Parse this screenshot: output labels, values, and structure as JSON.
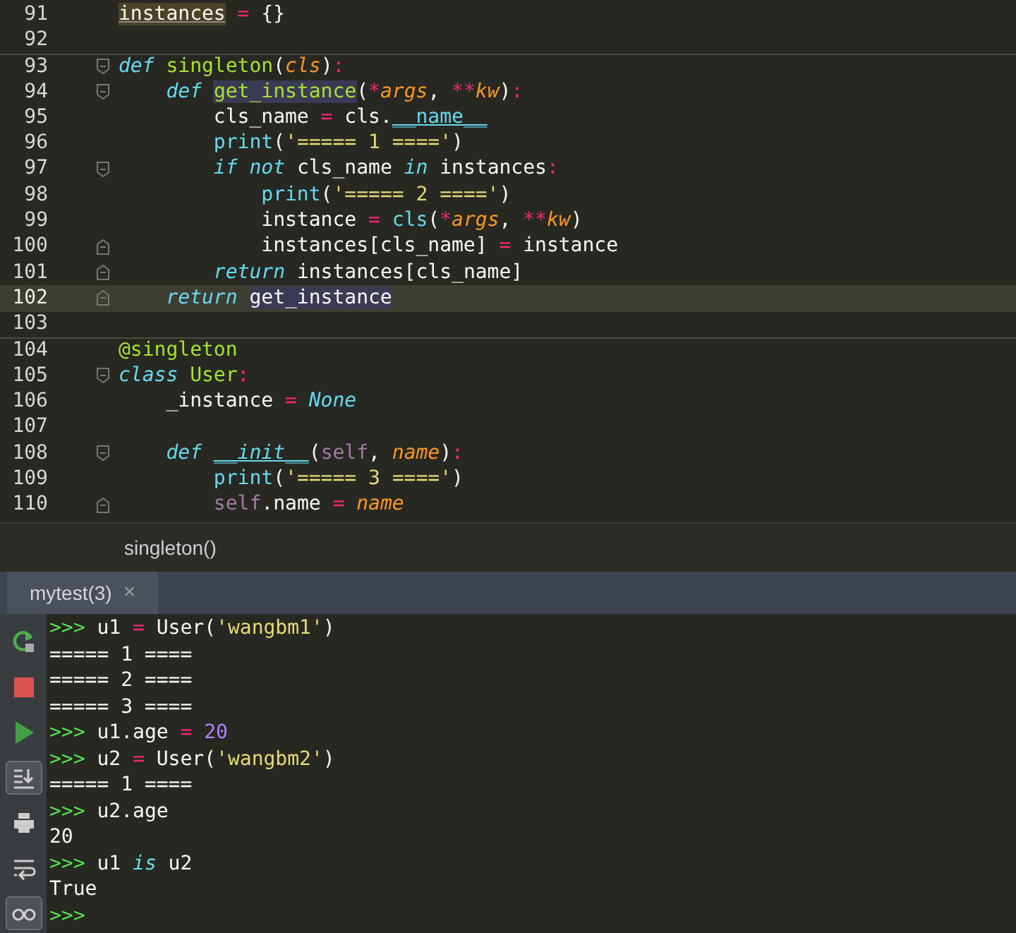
{
  "editor": {
    "lines": [
      {
        "number": "91",
        "current": false,
        "separator": false,
        "tokens": [
          {
            "text": "instances",
            "kind": "var-hl"
          },
          {
            "text": " = ",
            "kind": "op"
          },
          {
            "text": "{}",
            "kind": "plain"
          }
        ]
      },
      {
        "number": "92",
        "current": false,
        "separator": false
      },
      {
        "number": "93",
        "current": false,
        "separator": true,
        "kind": "opener",
        "tokens": [
          {
            "text": "def ",
            "kind": "kw"
          },
          {
            "text": "singleton",
            "kind": "fn"
          },
          {
            "text": "(",
            "kind": "plain"
          },
          {
            "text": "cls",
            "kind": "param"
          },
          {
            "text": ")",
            "kind": "plain"
          },
          {
            "text": ":",
            "kind": "op"
          }
        ]
      },
      {
        "number": "94",
        "current": false,
        "separator": false,
        "kind": "opener",
        "tokens": [
          {
            "text": "    def ",
            "kind": "kw"
          },
          {
            "text": "get_instance",
            "kind": "fn-hl"
          },
          {
            "text": "(",
            "kind": "plain"
          },
          {
            "text": "*",
            "kind": "op"
          },
          {
            "text": "args",
            "kind": "param"
          },
          {
            "text": ", ",
            "kind": "plain"
          },
          {
            "text": "**",
            "kind": "op"
          },
          {
            "text": "kw",
            "kind": "param"
          },
          {
            "text": ")",
            "kind": "plain"
          },
          {
            "text": ":",
            "kind": "op"
          }
        ]
      },
      {
        "number": "95",
        "current": false,
        "separator": false,
        "tokens": [
          {
            "text": "        cls_name ",
            "kind": "plain"
          },
          {
            "text": "=",
            "kind": "op"
          },
          {
            "text": " cls.",
            "kind": "plain"
          },
          {
            "text": "__name__",
            "kind": "dunder"
          }
        ]
      },
      {
        "number": "96",
        "current": false,
        "separator": false,
        "tokens": [
          {
            "text": "        print",
            "kind": "builtin"
          },
          {
            "text": "(",
            "kind": "plain"
          },
          {
            "text": "'===== 1 ===='",
            "kind": "str"
          },
          {
            "text": ")",
            "kind": "plain"
          }
        ]
      },
      {
        "number": "97",
        "current": false,
        "separator": false,
        "kind": "opener",
        "tokens": [
          {
            "text": "        if not",
            "kind": "kw"
          },
          {
            "text": " cls_name ",
            "kind": "plain"
          },
          {
            "text": "in",
            "kind": "kw"
          },
          {
            "text": " instances",
            "kind": "plain"
          },
          {
            "text": ":",
            "kind": "op"
          }
        ]
      },
      {
        "number": "98",
        "current": false,
        "separator": false,
        "tokens": [
          {
            "text": "            print",
            "kind": "builtin"
          },
          {
            "text": "(",
            "kind": "plain"
          },
          {
            "text": "'===== 2 ===='",
            "kind": "str"
          },
          {
            "text": ")",
            "kind": "plain"
          }
        ]
      },
      {
        "number": "99",
        "current": false,
        "separator": false,
        "tokens": [
          {
            "text": "            instance ",
            "kind": "plain"
          },
          {
            "text": "= ",
            "kind": "op"
          },
          {
            "text": "cls",
            "kind": "builtin"
          },
          {
            "text": "(",
            "kind": "plain"
          },
          {
            "text": "*",
            "kind": "op"
          },
          {
            "text": "args",
            "kind": "param"
          },
          {
            "text": ", ",
            "kind": "plain"
          },
          {
            "text": "**",
            "kind": "op"
          },
          {
            "text": "kw",
            "kind": "param"
          },
          {
            "text": ")",
            "kind": "plain"
          }
        ]
      },
      {
        "number": "100",
        "current": false,
        "separator": false,
        "kind": "closer",
        "tokens": [
          {
            "text": "            instances[cls_name] ",
            "kind": "plain"
          },
          {
            "text": "=",
            "kind": "op"
          },
          {
            "text": " instance",
            "kind": "plain"
          }
        ]
      },
      {
        "number": "101",
        "current": false,
        "separator": false,
        "kind": "closer",
        "tokens": [
          {
            "text": "        return",
            "kind": "kw"
          },
          {
            "text": " instances[cls_name]",
            "kind": "plain"
          }
        ]
      },
      {
        "number": "102",
        "current": true,
        "separator": false,
        "kind": "closer",
        "tokens": [
          {
            "text": "    return ",
            "kind": "kw"
          },
          {
            "text": "get_instance",
            "kind": "name-hl"
          }
        ]
      },
      {
        "number": "103",
        "current": false,
        "separator": false
      },
      {
        "number": "104",
        "current": false,
        "separator": true,
        "tokens": [
          {
            "text": "@singleton",
            "kind": "decorator"
          }
        ]
      },
      {
        "number": "105",
        "current": false,
        "separator": false,
        "kind": "opener",
        "tokens": [
          {
            "text": "class ",
            "kind": "kw"
          },
          {
            "text": "User",
            "kind": "fn"
          },
          {
            "text": ":",
            "kind": "op"
          }
        ]
      },
      {
        "number": "106",
        "current": false,
        "separator": false,
        "tokens": [
          {
            "text": "    _instance ",
            "kind": "plain"
          },
          {
            "text": "= ",
            "kind": "op"
          },
          {
            "text": "None",
            "kind": "kw"
          }
        ]
      },
      {
        "number": "107",
        "current": false,
        "separator": false
      },
      {
        "number": "108",
        "current": false,
        "separator": false,
        "kind": "opener",
        "tokens": [
          {
            "text": "    def ",
            "kind": "kw"
          },
          {
            "text": "__init__",
            "kind": "dunder-def"
          },
          {
            "text": "(",
            "kind": "plain"
          },
          {
            "text": "self",
            "kind": "self"
          },
          {
            "text": ", ",
            "kind": "plain"
          },
          {
            "text": "name",
            "kind": "param"
          },
          {
            "text": ")",
            "kind": "plain"
          },
          {
            "text": ":",
            "kind": "op"
          }
        ]
      },
      {
        "number": "109",
        "current": false,
        "separator": false,
        "tokens": [
          {
            "text": "        print",
            "kind": "builtin"
          },
          {
            "text": "(",
            "kind": "plain"
          },
          {
            "text": "'===== 3 ===='",
            "kind": "str"
          },
          {
            "text": ")",
            "kind": "plain"
          }
        ]
      },
      {
        "number": "110",
        "current": false,
        "separator": false,
        "kind": "closer",
        "tokens": [
          {
            "text": "        self",
            "kind": "self"
          },
          {
            "text": ".name ",
            "kind": "plain"
          },
          {
            "text": "= ",
            "kind": "op"
          },
          {
            "text": "name",
            "kind": "param"
          }
        ]
      }
    ]
  },
  "breadcrumb": "singleton()",
  "console_tab": {
    "label": "mytest(3)",
    "close": "×"
  },
  "toolbar": [
    {
      "kind": "rerun",
      "on": false
    },
    {
      "kind": "stop",
      "on": false
    },
    {
      "kind": "run",
      "on": false
    },
    {
      "kind": "scroll-end",
      "on": true
    },
    {
      "kind": "print",
      "on": false
    },
    {
      "kind": "wrap",
      "on": false
    },
    {
      "kind": "glasses",
      "on": true
    }
  ],
  "console": [
    [
      {
        "text": ">>>",
        "kind": "prompt"
      },
      {
        "text": " u1 ",
        "kind": "plain"
      },
      {
        "text": "=",
        "kind": "op"
      },
      {
        "text": " User(",
        "kind": "plain"
      },
      {
        "text": "'wangbm1'",
        "kind": "str"
      },
      {
        "text": ")",
        "kind": "plain"
      }
    ],
    [
      {
        "text": "===== 1 ====",
        "kind": "plain"
      }
    ],
    [
      {
        "text": "===== 2 ====",
        "kind": "plain"
      }
    ],
    [
      {
        "text": "===== 3 ====",
        "kind": "plain"
      }
    ],
    [
      {
        "text": ">>>",
        "kind": "prompt"
      },
      {
        "text": " u1.age ",
        "kind": "plain"
      },
      {
        "text": "= ",
        "kind": "op"
      },
      {
        "text": "20",
        "kind": "num"
      }
    ],
    [
      {
        "text": ">>>",
        "kind": "prompt"
      },
      {
        "text": " u2 ",
        "kind": "plain"
      },
      {
        "text": "=",
        "kind": "op"
      },
      {
        "text": " User(",
        "kind": "plain"
      },
      {
        "text": "'wangbm2'",
        "kind": "str"
      },
      {
        "text": ")",
        "kind": "plain"
      }
    ],
    [
      {
        "text": "===== 1 ====",
        "kind": "plain"
      }
    ],
    [
      {
        "text": ">>>",
        "kind": "prompt"
      },
      {
        "text": " u2.age",
        "kind": "plain"
      }
    ],
    [
      {
        "text": "20",
        "kind": "plain"
      }
    ],
    [
      {
        "text": ">>>",
        "kind": "prompt"
      },
      {
        "text": " u1 ",
        "kind": "plain"
      },
      {
        "text": "is",
        "kind": "kw"
      },
      {
        "text": " u2",
        "kind": "plain"
      }
    ],
    [
      {
        "text": "True",
        "kind": "plain"
      }
    ],
    [
      {
        "text": ">>>",
        "kind": "prompt"
      }
    ]
  ]
}
